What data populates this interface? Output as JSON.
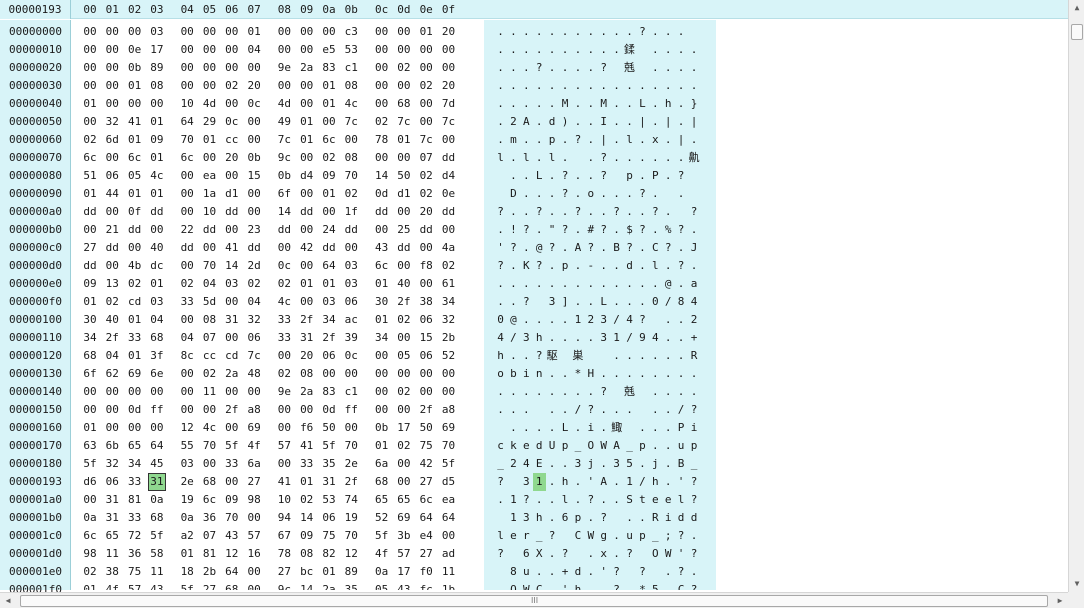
{
  "header": {
    "address": "00000193",
    "columns": [
      "00",
      "01",
      "02",
      "03",
      "04",
      "05",
      "06",
      "07",
      "08",
      "09",
      "0a",
      "0b",
      "0c",
      "0d",
      "0e",
      "0f"
    ]
  },
  "selection": {
    "row": 25,
    "col": 3
  },
  "rows": [
    {
      "addr": "00000000",
      "hex": [
        "00",
        "00",
        "00",
        "03",
        "00",
        "00",
        "00",
        "01",
        "00",
        "00",
        "00",
        "c3",
        "00",
        "00",
        "01",
        "20"
      ],
      "ascii": [
        ".",
        ".",
        ".",
        ".",
        ".",
        ".",
        ".",
        ".",
        ".",
        ".",
        ".",
        "?",
        ".",
        ".",
        ".",
        ""
      ]
    },
    {
      "addr": "00000010",
      "hex": [
        "00",
        "00",
        "0e",
        "17",
        "00",
        "00",
        "00",
        "04",
        "00",
        "00",
        "e5",
        "53",
        "00",
        "00",
        "00",
        "00"
      ],
      "ascii": [
        ".",
        ".",
        ".",
        ".",
        ".",
        ".",
        ".",
        ".",
        ".",
        ".",
        "鍒",
        "",
        ".",
        ".",
        ".",
        "."
      ]
    },
    {
      "addr": "00000020",
      "hex": [
        "00",
        "00",
        "0b",
        "89",
        "00",
        "00",
        "00",
        "00",
        "9e",
        "2a",
        "83",
        "c1",
        "00",
        "02",
        "00",
        "00"
      ],
      "ascii": [
        ".",
        ".",
        ".",
        "?",
        ".",
        ".",
        ".",
        ".",
        "?",
        "",
        "兞",
        "",
        ".",
        ".",
        ".",
        "."
      ]
    },
    {
      "addr": "00000030",
      "hex": [
        "00",
        "00",
        "01",
        "08",
        "00",
        "00",
        "02",
        "20",
        "00",
        "00",
        "01",
        "08",
        "00",
        "00",
        "02",
        "20"
      ],
      "ascii": [
        ".",
        ".",
        ".",
        ".",
        ".",
        ".",
        ".",
        ".",
        ".",
        ".",
        ".",
        ".",
        ".",
        ".",
        ".",
        "."
      ]
    },
    {
      "addr": "00000040",
      "hex": [
        "01",
        "00",
        "00",
        "00",
        "10",
        "4d",
        "00",
        "0c",
        "4d",
        "00",
        "01",
        "4c",
        "00",
        "68",
        "00",
        "7d"
      ],
      "ascii": [
        ".",
        ".",
        ".",
        ".",
        ".",
        "M",
        ".",
        ".",
        "M",
        ".",
        ".",
        "L",
        ".",
        "h",
        ".",
        "}"
      ]
    },
    {
      "addr": "00000050",
      "hex": [
        "00",
        "32",
        "41",
        "01",
        "64",
        "29",
        "0c",
        "00",
        "49",
        "01",
        "00",
        "7c",
        "02",
        "7c",
        "00",
        "7c"
      ],
      "ascii": [
        ".",
        "2",
        "A",
        ".",
        "d",
        ")",
        ".",
        ".",
        "I",
        ".",
        ".",
        "|",
        ".",
        "|",
        ".",
        "|"
      ]
    },
    {
      "addr": "00000060",
      "hex": [
        "02",
        "6d",
        "01",
        "09",
        "70",
        "01",
        "cc",
        "00",
        "7c",
        "01",
        "6c",
        "00",
        "78",
        "01",
        "7c",
        "00"
      ],
      "ascii": [
        ".",
        "m",
        ".",
        ".",
        "p",
        ".",
        "?",
        ".",
        "|",
        ".",
        "l",
        ".",
        "x",
        ".",
        "|",
        "."
      ]
    },
    {
      "addr": "00000070",
      "hex": [
        "6c",
        "00",
        "6c",
        "01",
        "6c",
        "00",
        "20",
        "0b",
        "9c",
        "00",
        "02",
        "08",
        "00",
        "00",
        "07",
        "dd"
      ],
      "ascii": [
        "l",
        ".",
        "l",
        ".",
        "l",
        ".",
        "",
        ".",
        "?",
        ".",
        ".",
        ".",
        ".",
        ".",
        ".",
        "鼽"
      ]
    },
    {
      "addr": "00000080",
      "hex": [
        "51",
        "06",
        "05",
        "4c",
        "00",
        "ea",
        "00",
        "15",
        "0b",
        "d4",
        "09",
        "70",
        "14",
        "50",
        "02",
        "d4"
      ],
      "ascii": [
        "",
        ".",
        ".",
        "L",
        ".",
        "?",
        ".",
        ".",
        "?",
        "",
        "p",
        ".",
        "P",
        ".",
        "?",
        ""
      ]
    },
    {
      "addr": "00000090",
      "hex": [
        "01",
        "44",
        "01",
        "01",
        "00",
        "1a",
        "d1",
        "00",
        "6f",
        "00",
        "01",
        "02",
        "0d",
        "d1",
        "02",
        "0e"
      ],
      "ascii": [
        "",
        "D",
        ".",
        ".",
        ".",
        "?",
        ".",
        "o",
        ".",
        ".",
        ".",
        "?",
        ".",
        "",
        ".",
        ""
      ]
    },
    {
      "addr": "000000a0",
      "hex": [
        "dd",
        "00",
        "0f",
        "dd",
        "00",
        "10",
        "dd",
        "00",
        "14",
        "dd",
        "00",
        "1f",
        "dd",
        "00",
        "20",
        "dd"
      ],
      "ascii": [
        "?",
        ".",
        ".",
        "?",
        ".",
        ".",
        "?",
        ".",
        ".",
        "?",
        ".",
        ".",
        "?",
        ".",
        "",
        "?"
      ]
    },
    {
      "addr": "000000b0",
      "hex": [
        "00",
        "21",
        "dd",
        "00",
        "22",
        "dd",
        "00",
        "23",
        "dd",
        "00",
        "24",
        "dd",
        "00",
        "25",
        "dd",
        "00"
      ],
      "ascii": [
        ".",
        "!",
        "?",
        ".",
        "\"",
        "?",
        ".",
        "#",
        "?",
        ".",
        "$",
        "?",
        ".",
        "%",
        "?",
        "."
      ]
    },
    {
      "addr": "000000c0",
      "hex": [
        "27",
        "dd",
        "00",
        "40",
        "dd",
        "00",
        "41",
        "dd",
        "00",
        "42",
        "dd",
        "00",
        "43",
        "dd",
        "00",
        "4a"
      ],
      "ascii": [
        "'",
        "?",
        ".",
        "@",
        "?",
        ".",
        "A",
        "?",
        ".",
        "B",
        "?",
        ".",
        "C",
        "?",
        ".",
        "J"
      ]
    },
    {
      "addr": "000000d0",
      "hex": [
        "dd",
        "00",
        "4b",
        "dc",
        "00",
        "70",
        "14",
        "2d",
        "0c",
        "00",
        "64",
        "03",
        "6c",
        "00",
        "f8",
        "02"
      ],
      "ascii": [
        "?",
        ".",
        "K",
        "?",
        ".",
        "p",
        ".",
        "-",
        ".",
        ".",
        "d",
        ".",
        "l",
        ".",
        "?",
        "."
      ]
    },
    {
      "addr": "000000e0",
      "hex": [
        "09",
        "13",
        "02",
        "01",
        "02",
        "04",
        "03",
        "02",
        "02",
        "01",
        "01",
        "03",
        "01",
        "40",
        "00",
        "61"
      ],
      "ascii": [
        ".",
        ".",
        ".",
        ".",
        ".",
        ".",
        ".",
        ".",
        ".",
        ".",
        ".",
        ".",
        ".",
        "@",
        ".",
        "a"
      ]
    },
    {
      "addr": "000000f0",
      "hex": [
        "01",
        "02",
        "cd",
        "03",
        "33",
        "5d",
        "00",
        "04",
        "4c",
        "00",
        "03",
        "06",
        "30",
        "2f",
        "38",
        "34"
      ],
      "ascii": [
        ".",
        ".",
        "?",
        "",
        "3",
        "]",
        ".",
        ".",
        "L",
        ".",
        ".",
        ".",
        "0",
        "/",
        "8",
        "4"
      ]
    },
    {
      "addr": "00000100",
      "hex": [
        "30",
        "40",
        "01",
        "04",
        "00",
        "08",
        "31",
        "32",
        "33",
        "2f",
        "34",
        "ac",
        "01",
        "02",
        "06",
        "32"
      ],
      "ascii": [
        "0",
        "@",
        ".",
        ".",
        ".",
        ".",
        "1",
        "2",
        "3",
        "/",
        "4",
        "?",
        "",
        ".",
        ".",
        "2"
      ]
    },
    {
      "addr": "00000110",
      "hex": [
        "34",
        "2f",
        "33",
        "68",
        "04",
        "07",
        "00",
        "06",
        "33",
        "31",
        "2f",
        "39",
        "34",
        "00",
        "15",
        "2b"
      ],
      "ascii": [
        "4",
        "/",
        "3",
        "h",
        ".",
        ".",
        ".",
        ".",
        "3",
        "1",
        "/",
        "9",
        "4",
        ".",
        ".",
        "+"
      ]
    },
    {
      "addr": "00000120",
      "hex": [
        "68",
        "04",
        "01",
        "3f",
        "8c",
        "cc",
        "cd",
        "7c",
        "00",
        "20",
        "06",
        "0c",
        "00",
        "05",
        "06",
        "52"
      ],
      "ascii": [
        "h",
        ".",
        ".",
        "?",
        "駆",
        "",
        "巣",
        "",
        "",
        ".",
        ".",
        ".",
        ".",
        ".",
        ".",
        "R"
      ]
    },
    {
      "addr": "00000130",
      "hex": [
        "6f",
        "62",
        "69",
        "6e",
        "00",
        "02",
        "2a",
        "48",
        "02",
        "08",
        "00",
        "00",
        "00",
        "00",
        "00",
        "00"
      ],
      "ascii": [
        "o",
        "b",
        "i",
        "n",
        ".",
        ".",
        "*",
        "H",
        ".",
        ".",
        ".",
        ".",
        ".",
        ".",
        ".",
        "."
      ]
    },
    {
      "addr": "00000140",
      "hex": [
        "00",
        "00",
        "00",
        "00",
        "00",
        "11",
        "00",
        "00",
        "9e",
        "2a",
        "83",
        "c1",
        "00",
        "02",
        "00",
        "00"
      ],
      "ascii": [
        ".",
        ".",
        ".",
        ".",
        ".",
        ".",
        ".",
        ".",
        "?",
        "",
        "兞",
        "",
        ".",
        ".",
        ".",
        "."
      ]
    },
    {
      "addr": "00000150",
      "hex": [
        "00",
        "00",
        "0d",
        "ff",
        "00",
        "00",
        "2f",
        "a8",
        "00",
        "00",
        "0d",
        "ff",
        "00",
        "00",
        "2f",
        "a8"
      ],
      "ascii": [
        ".",
        ".",
        ".",
        "",
        ".",
        ".",
        "/",
        "?",
        ".",
        ".",
        ".",
        "",
        ".",
        ".",
        "/",
        "?"
      ]
    },
    {
      "addr": "00000160",
      "hex": [
        "01",
        "00",
        "00",
        "00",
        "12",
        "4c",
        "00",
        "69",
        "00",
        "f6",
        "50",
        "00",
        "0b",
        "17",
        "50",
        "69"
      ],
      "ascii": [
        "",
        ".",
        ".",
        ".",
        ".",
        "L",
        ".",
        "i",
        ".",
        "鯫",
        "",
        ".",
        ".",
        ".",
        "P",
        "i"
      ]
    },
    {
      "addr": "00000170",
      "hex": [
        "63",
        "6b",
        "65",
        "64",
        "55",
        "70",
        "5f",
        "4f",
        "57",
        "41",
        "5f",
        "70",
        "01",
        "02",
        "75",
        "70"
      ],
      "ascii": [
        "c",
        "k",
        "e",
        "d",
        "U",
        "p",
        "_",
        "O",
        "W",
        "A",
        "_",
        "p",
        ".",
        ".",
        "u",
        "p"
      ]
    },
    {
      "addr": "00000180",
      "hex": [
        "5f",
        "32",
        "34",
        "45",
        "03",
        "00",
        "33",
        "6a",
        "00",
        "33",
        "35",
        "2e",
        "6a",
        "00",
        "42",
        "5f"
      ],
      "ascii": [
        "_",
        "2",
        "4",
        "E",
        ".",
        ".",
        "3",
        "j",
        ".",
        "3",
        "5",
        ".",
        "j",
        ".",
        "B",
        "_"
      ]
    },
    {
      "addr": "00000193",
      "hex": [
        "d6",
        "06",
        "33",
        "31",
        "2e",
        "68",
        "00",
        "27",
        "41",
        "01",
        "31",
        "2f",
        "68",
        "00",
        "27",
        "d5"
      ],
      "ascii": [
        "?",
        "",
        "3",
        "1",
        ".",
        "h",
        ".",
        "'",
        "A",
        ".",
        "1",
        "/",
        "h",
        ".",
        "'",
        "?"
      ]
    },
    {
      "addr": "000001a0",
      "hex": [
        "00",
        "31",
        "81",
        "0a",
        "19",
        "6c",
        "09",
        "98",
        "10",
        "02",
        "53",
        "74",
        "65",
        "65",
        "6c",
        "ea"
      ],
      "ascii": [
        ".",
        "1",
        "?",
        ".",
        ".",
        "l",
        ".",
        "?",
        ".",
        ".",
        "S",
        "t",
        "e",
        "e",
        "l",
        "?"
      ]
    },
    {
      "addr": "000001b0",
      "hex": [
        "0a",
        "31",
        "33",
        "68",
        "0a",
        "36",
        "70",
        "00",
        "94",
        "14",
        "06",
        "19",
        "52",
        "69",
        "64",
        "64"
      ],
      "ascii": [
        "",
        "1",
        "3",
        "h",
        ".",
        "6",
        "p",
        ".",
        "?",
        "",
        ".",
        ".",
        "R",
        "i",
        "d",
        "d"
      ]
    },
    {
      "addr": "000001c0",
      "hex": [
        "6c",
        "65",
        "72",
        "5f",
        "a2",
        "07",
        "43",
        "57",
        "67",
        "09",
        "75",
        "70",
        "5f",
        "3b",
        "e4",
        "00"
      ],
      "ascii": [
        "l",
        "e",
        "r",
        "_",
        "?",
        "",
        "C",
        "W",
        "g",
        ".",
        "u",
        "p",
        "_",
        ";",
        "?",
        "."
      ]
    },
    {
      "addr": "000001d0",
      "hex": [
        "98",
        "11",
        "36",
        "58",
        "01",
        "81",
        "12",
        "16",
        "78",
        "08",
        "82",
        "12",
        "4f",
        "57",
        "27",
        "ad"
      ],
      "ascii": [
        "?",
        "",
        "6",
        "X",
        ".",
        "?",
        "",
        ".",
        "x",
        ".",
        "?",
        "",
        "O",
        "W",
        "'",
        "?"
      ]
    },
    {
      "addr": "000001e0",
      "hex": [
        "02",
        "38",
        "75",
        "11",
        "18",
        "2b",
        "64",
        "00",
        "27",
        "bc",
        "01",
        "89",
        "0a",
        "17",
        "f0",
        "11"
      ],
      "ascii": [
        "",
        "8",
        "u",
        ".",
        ".",
        "+",
        "d",
        ".",
        "'",
        "?",
        "",
        "?",
        "",
        ".",
        "?",
        "."
      ]
    },
    {
      "addr": "000001f0",
      "hex": [
        "01",
        "4f",
        "57",
        "43",
        "5f",
        "27",
        "68",
        "00",
        "9c",
        "14",
        "2a",
        "35",
        "05",
        "43",
        "fc",
        "1b"
      ],
      "ascii": [
        "",
        "O",
        "W",
        "C",
        ".",
        "'",
        "h",
        "",
        ".",
        "?",
        "",
        "*",
        "5",
        "",
        "C",
        "?"
      ]
    }
  ],
  "scrollbar": {
    "grip": "III"
  }
}
